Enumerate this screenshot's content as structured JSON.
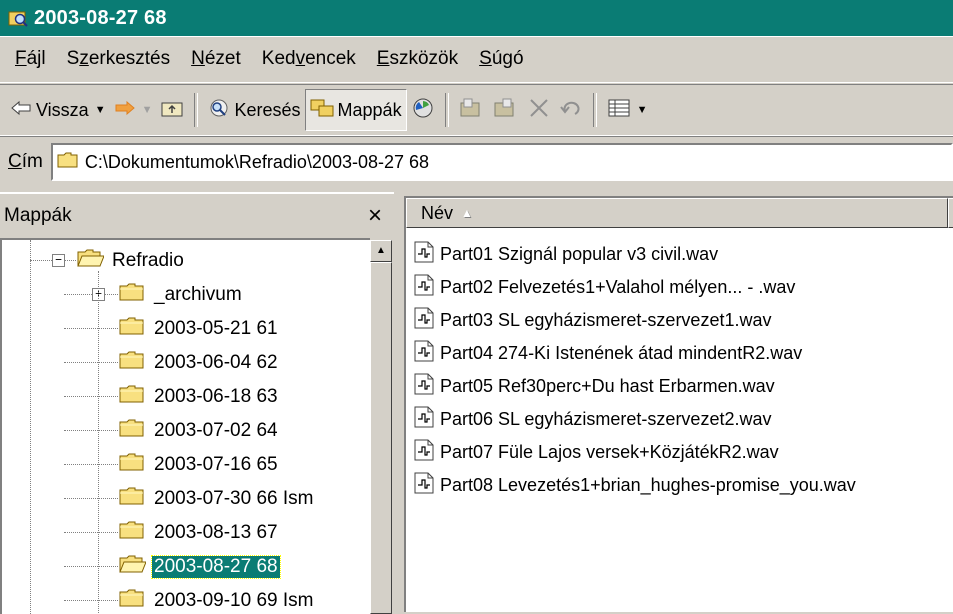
{
  "window": {
    "title": "2003-08-27 68"
  },
  "menu": [
    {
      "pre": "",
      "u": "F",
      "post": "ájl"
    },
    {
      "pre": "S",
      "u": "z",
      "post": "erkesztés"
    },
    {
      "pre": "",
      "u": "N",
      "post": "ézet"
    },
    {
      "pre": "Ked",
      "u": "v",
      "post": "encek"
    },
    {
      "pre": "",
      "u": "E",
      "post": "szközök"
    },
    {
      "pre": "",
      "u": "S",
      "post": "úgó"
    }
  ],
  "toolbar": {
    "back_label": "Vissza",
    "search_label": "Keresés",
    "folders_label": "Mappák"
  },
  "address": {
    "label_u": "C",
    "label_rest": "ím",
    "path": "C:\\Dokumentumok\\Refradio\\2003-08-27 68"
  },
  "folders_pane": {
    "title": "Mappák",
    "close": "×",
    "tree": [
      {
        "label": "Refradio",
        "level": 0,
        "expander": "−",
        "open": true
      },
      {
        "label": "_archivum",
        "level": 1,
        "expander": "+"
      },
      {
        "label": "2003-05-21 61",
        "level": 1
      },
      {
        "label": "2003-06-04 62",
        "level": 1
      },
      {
        "label": "2003-06-18 63",
        "level": 1
      },
      {
        "label": "2003-07-02 64",
        "level": 1
      },
      {
        "label": "2003-07-16 65",
        "level": 1
      },
      {
        "label": "2003-07-30 66 Ism",
        "level": 1
      },
      {
        "label": "2003-08-13 67",
        "level": 1
      },
      {
        "label": "2003-08-27 68",
        "level": 1,
        "selected": true,
        "open": true
      },
      {
        "label": "2003-09-10 69 Ism",
        "level": 1
      }
    ]
  },
  "file_list": {
    "column_name": "Név",
    "files": [
      "Part01 Szignál popular v3 civil.wav",
      "Part02 Felvezetés1+Valahol mélyen... - .wav",
      "Part03 SL egyházismeret-szervezet1.wav",
      "Part04 274-Ki Istenének átad mindentR2.wav",
      "Part05 Ref30perc+Du hast Erbarmen.wav",
      "Part06 SL egyházismeret-szervezet2.wav",
      "Part07 Füle Lajos versek+KözjátékR2.wav",
      "Part08 Levezetés1+brian_hughes-promise_you.wav"
    ]
  },
  "colors": {
    "titlebar": "#0a7c74",
    "selection": "#0a7c74",
    "chrome": "#d4d0c8"
  }
}
